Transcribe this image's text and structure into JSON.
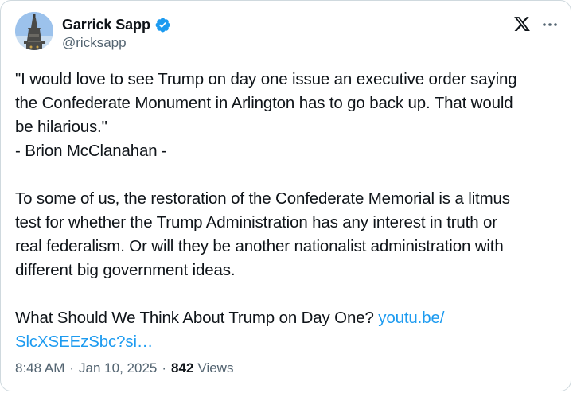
{
  "author": {
    "name": "Garrick Sapp",
    "handle": "@ricksapp",
    "verified": true,
    "verified_color": "#1d9bf0",
    "avatar_icon": "monument-statue-avatar"
  },
  "header_actions": {
    "logo_icon": "x-logo-icon",
    "more_icon": "more-horizontal-icon"
  },
  "tweet": {
    "line1": "\"I would love to see Trump on day one issue an executive order saying",
    "line2": "the Confederate Monument in Arlington has to go back up. That would",
    "line3": "be hilarious.\"",
    "line4": "- Brion McClanahan -",
    "para2_line1": "To some of us, the restoration of the Confederate Memorial is a litmus",
    "para2_line2": "test for whether the Trump Administration has any interest in truth or",
    "para2_line3": "real federalism. Or will they be another nationalist administration with",
    "para2_line4": "different big government ideas.",
    "para3_text": "What Should We Think About Trump on Day One? ",
    "link_part1": "youtu.be/",
    "link_part2": "SlcXSEEzSbc?si…"
  },
  "meta": {
    "time": "8:48 AM",
    "separator1": "·",
    "date": "Jan 10, 2025",
    "separator2": "·",
    "views_count": "842",
    "views_label": "Views"
  },
  "colors": {
    "text": "#0f1419",
    "secondary": "#536471",
    "link": "#1d9bf0",
    "border": "#cfd9de"
  }
}
